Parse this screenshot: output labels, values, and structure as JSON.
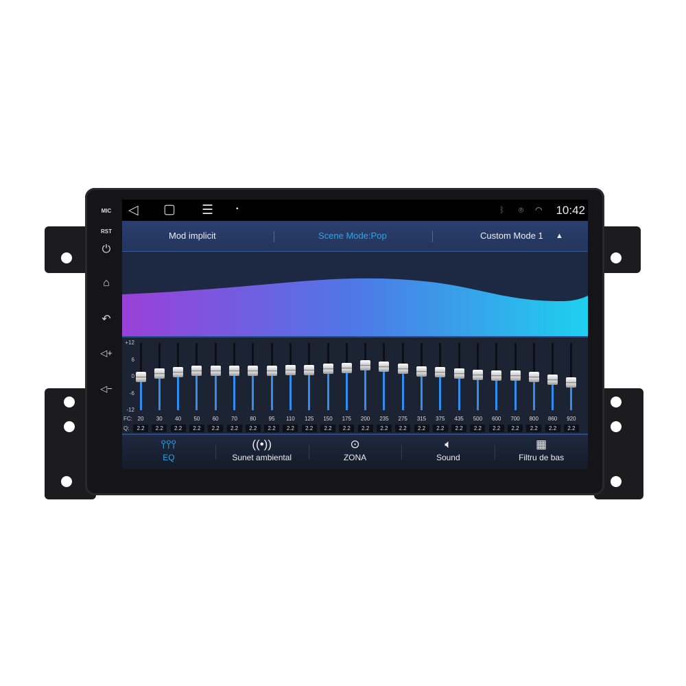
{
  "device": {
    "side_buttons": [
      {
        "label": "MIC",
        "icon": "mic-label"
      },
      {
        "label": "RST",
        "icon": "reset-label"
      },
      {
        "label": "",
        "icon": "power-icon"
      },
      {
        "label": "",
        "icon": "home-icon"
      },
      {
        "label": "",
        "icon": "back-icon"
      },
      {
        "label": "",
        "icon": "volume-up-icon"
      },
      {
        "label": "",
        "icon": "volume-down-icon"
      }
    ]
  },
  "status_bar": {
    "time": "10:42",
    "icons": [
      "bluetooth-icon",
      "location-icon",
      "wifi-icon"
    ],
    "nav": [
      "back-icon",
      "home-icon",
      "menu-icon",
      "gallery-icon"
    ]
  },
  "header": {
    "left": "Mod implicit",
    "center": "Scene Mode:Pop",
    "right": "Custom Mode 1",
    "accent": "#2aa6e8"
  },
  "eq": {
    "scale_labels": [
      "+12",
      "6",
      "0",
      "-6",
      "-12"
    ],
    "range": [
      -12,
      12
    ],
    "fc_label": "FC:",
    "q_label": "Q:",
    "bands": [
      {
        "fc": "20",
        "q": "2.2",
        "gain": 0
      },
      {
        "fc": "30",
        "q": "2.2",
        "gain": 1
      },
      {
        "fc": "40",
        "q": "2.2",
        "gain": 1.5
      },
      {
        "fc": "50",
        "q": "2.2",
        "gain": 2
      },
      {
        "fc": "60",
        "q": "2.2",
        "gain": 2
      },
      {
        "fc": "70",
        "q": "2.2",
        "gain": 2
      },
      {
        "fc": "80",
        "q": "2.2",
        "gain": 2
      },
      {
        "fc": "95",
        "q": "2.2",
        "gain": 2
      },
      {
        "fc": "110",
        "q": "2.2",
        "gain": 2.3
      },
      {
        "fc": "125",
        "q": "2.2",
        "gain": 2.3
      },
      {
        "fc": "150",
        "q": "2.2",
        "gain": 2.7
      },
      {
        "fc": "175",
        "q": "2.2",
        "gain": 3
      },
      {
        "fc": "200",
        "q": "2.2",
        "gain": 4
      },
      {
        "fc": "235",
        "q": "2.2",
        "gain": 3.5
      },
      {
        "fc": "275",
        "q": "2.2",
        "gain": 2.8
      },
      {
        "fc": "315",
        "q": "2.2",
        "gain": 1.8
      },
      {
        "fc": "375",
        "q": "2.2",
        "gain": 1.5
      },
      {
        "fc": "435",
        "q": "2.2",
        "gain": 1
      },
      {
        "fc": "500",
        "q": "2.2",
        "gain": 0.5
      },
      {
        "fc": "600",
        "q": "2.2",
        "gain": 0.3
      },
      {
        "fc": "700",
        "q": "2.2",
        "gain": 0.3
      },
      {
        "fc": "800",
        "q": "2.2",
        "gain": 0
      },
      {
        "fc": "860",
        "q": "2.2",
        "gain": -1
      },
      {
        "fc": "920",
        "q": "2.2",
        "gain": -2
      }
    ]
  },
  "tabs": [
    {
      "label": "EQ",
      "icon": "equalizer-icon",
      "glyph": "⫯⫯⫯",
      "active": true
    },
    {
      "label": "Sunet ambiental",
      "icon": "surround-icon",
      "glyph": "((•))"
    },
    {
      "label": "ZONA",
      "icon": "zone-target-icon",
      "glyph": "⊙"
    },
    {
      "label": "Sound",
      "icon": "speaker-icon",
      "glyph": "🔈︎"
    },
    {
      "label": "Filtru de bas",
      "icon": "bass-filter-icon",
      "glyph": "▦"
    }
  ]
}
